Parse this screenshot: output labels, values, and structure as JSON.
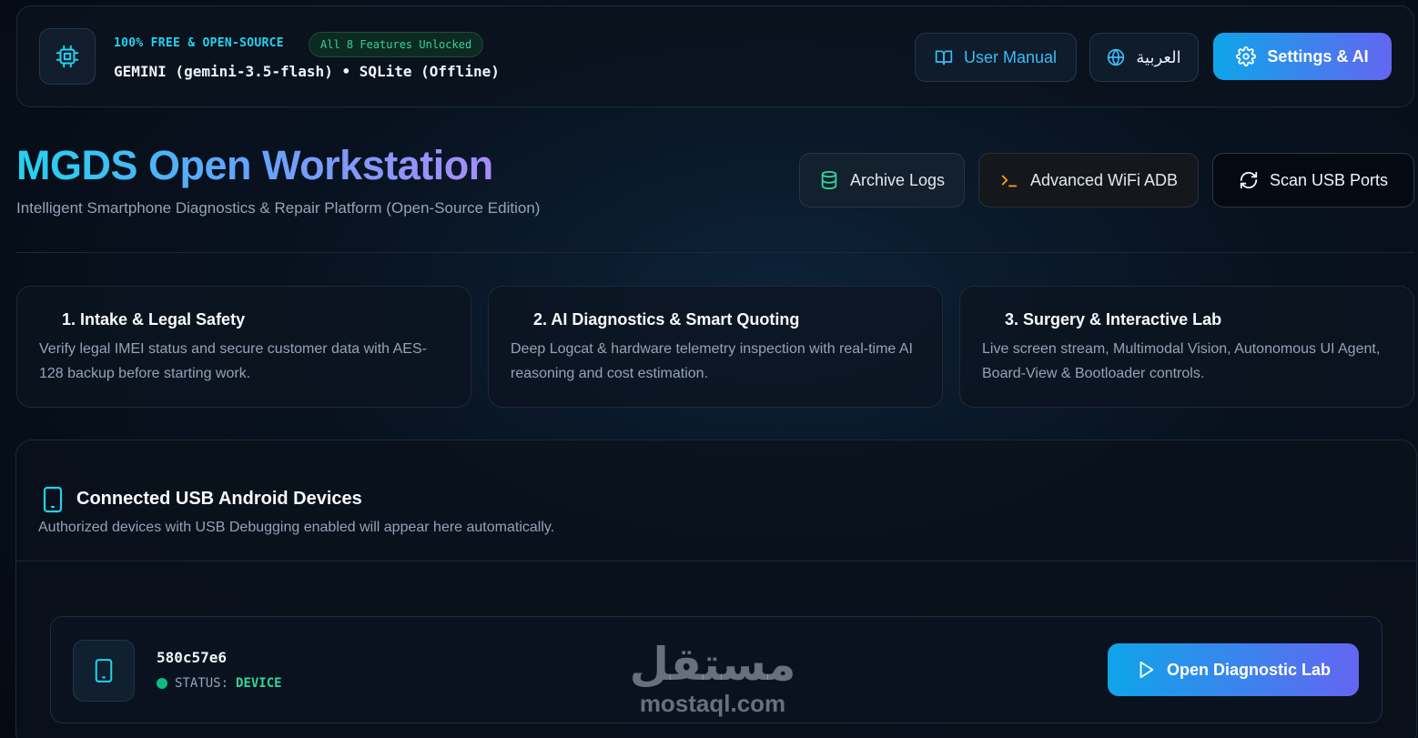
{
  "header": {
    "tagline": "100% FREE & OPEN-SOURCE",
    "features_badge": "All 8 Features Unlocked",
    "model_line": "GEMINI (gemini-3.5-flash) • SQLite (Offline)",
    "manual_label": "User Manual",
    "language_label": "العربية",
    "settings_label": "Settings & AI"
  },
  "hero": {
    "title": "MGDS Open Workstation",
    "subtitle": "Intelligent Smartphone Diagnostics & Repair Platform (Open-Source Edition)",
    "archive_label": "Archive Logs",
    "wifi_label": "Advanced WiFi ADB",
    "scan_label": "Scan USB Ports"
  },
  "steps": [
    {
      "title": "1. Intake & Legal Safety",
      "description": "Verify legal IMEI status and secure customer data with AES-128 backup before starting work."
    },
    {
      "title": "2. AI Diagnostics & Smart Quoting",
      "description": "Deep Logcat & hardware telemetry inspection with real-time AI reasoning and cost estimation."
    },
    {
      "title": "3. Surgery & Interactive Lab",
      "description": "Live screen stream, Multimodal Vision, Autonomous UI Agent, Board-View & Bootloader controls."
    }
  ],
  "devices": {
    "title": "Connected USB Android Devices",
    "subtitle": "Authorized devices with USB Debugging enabled will appear here automatically.",
    "list": [
      {
        "id": "580c57e6",
        "status_label": "STATUS:",
        "status_value": "DEVICE",
        "open_label": "Open Diagnostic Lab"
      }
    ]
  },
  "watermark": {
    "arabic": "مستقل",
    "latin": "mostaql.com"
  },
  "colors": {
    "accent_cyan": "#22d3ee",
    "accent_indigo": "#6366f1",
    "success_green": "#34d399",
    "warning_amber": "#f59e0b"
  },
  "icons": {
    "chip": "cpu-chip-icon",
    "manual": "book-open-icon",
    "language": "globe-icon",
    "settings": "gear-icon",
    "archive": "database-icon",
    "wifi_adb": "terminal-icon",
    "scan": "refresh-icon",
    "device": "smartphone-icon",
    "open": "play-icon"
  }
}
